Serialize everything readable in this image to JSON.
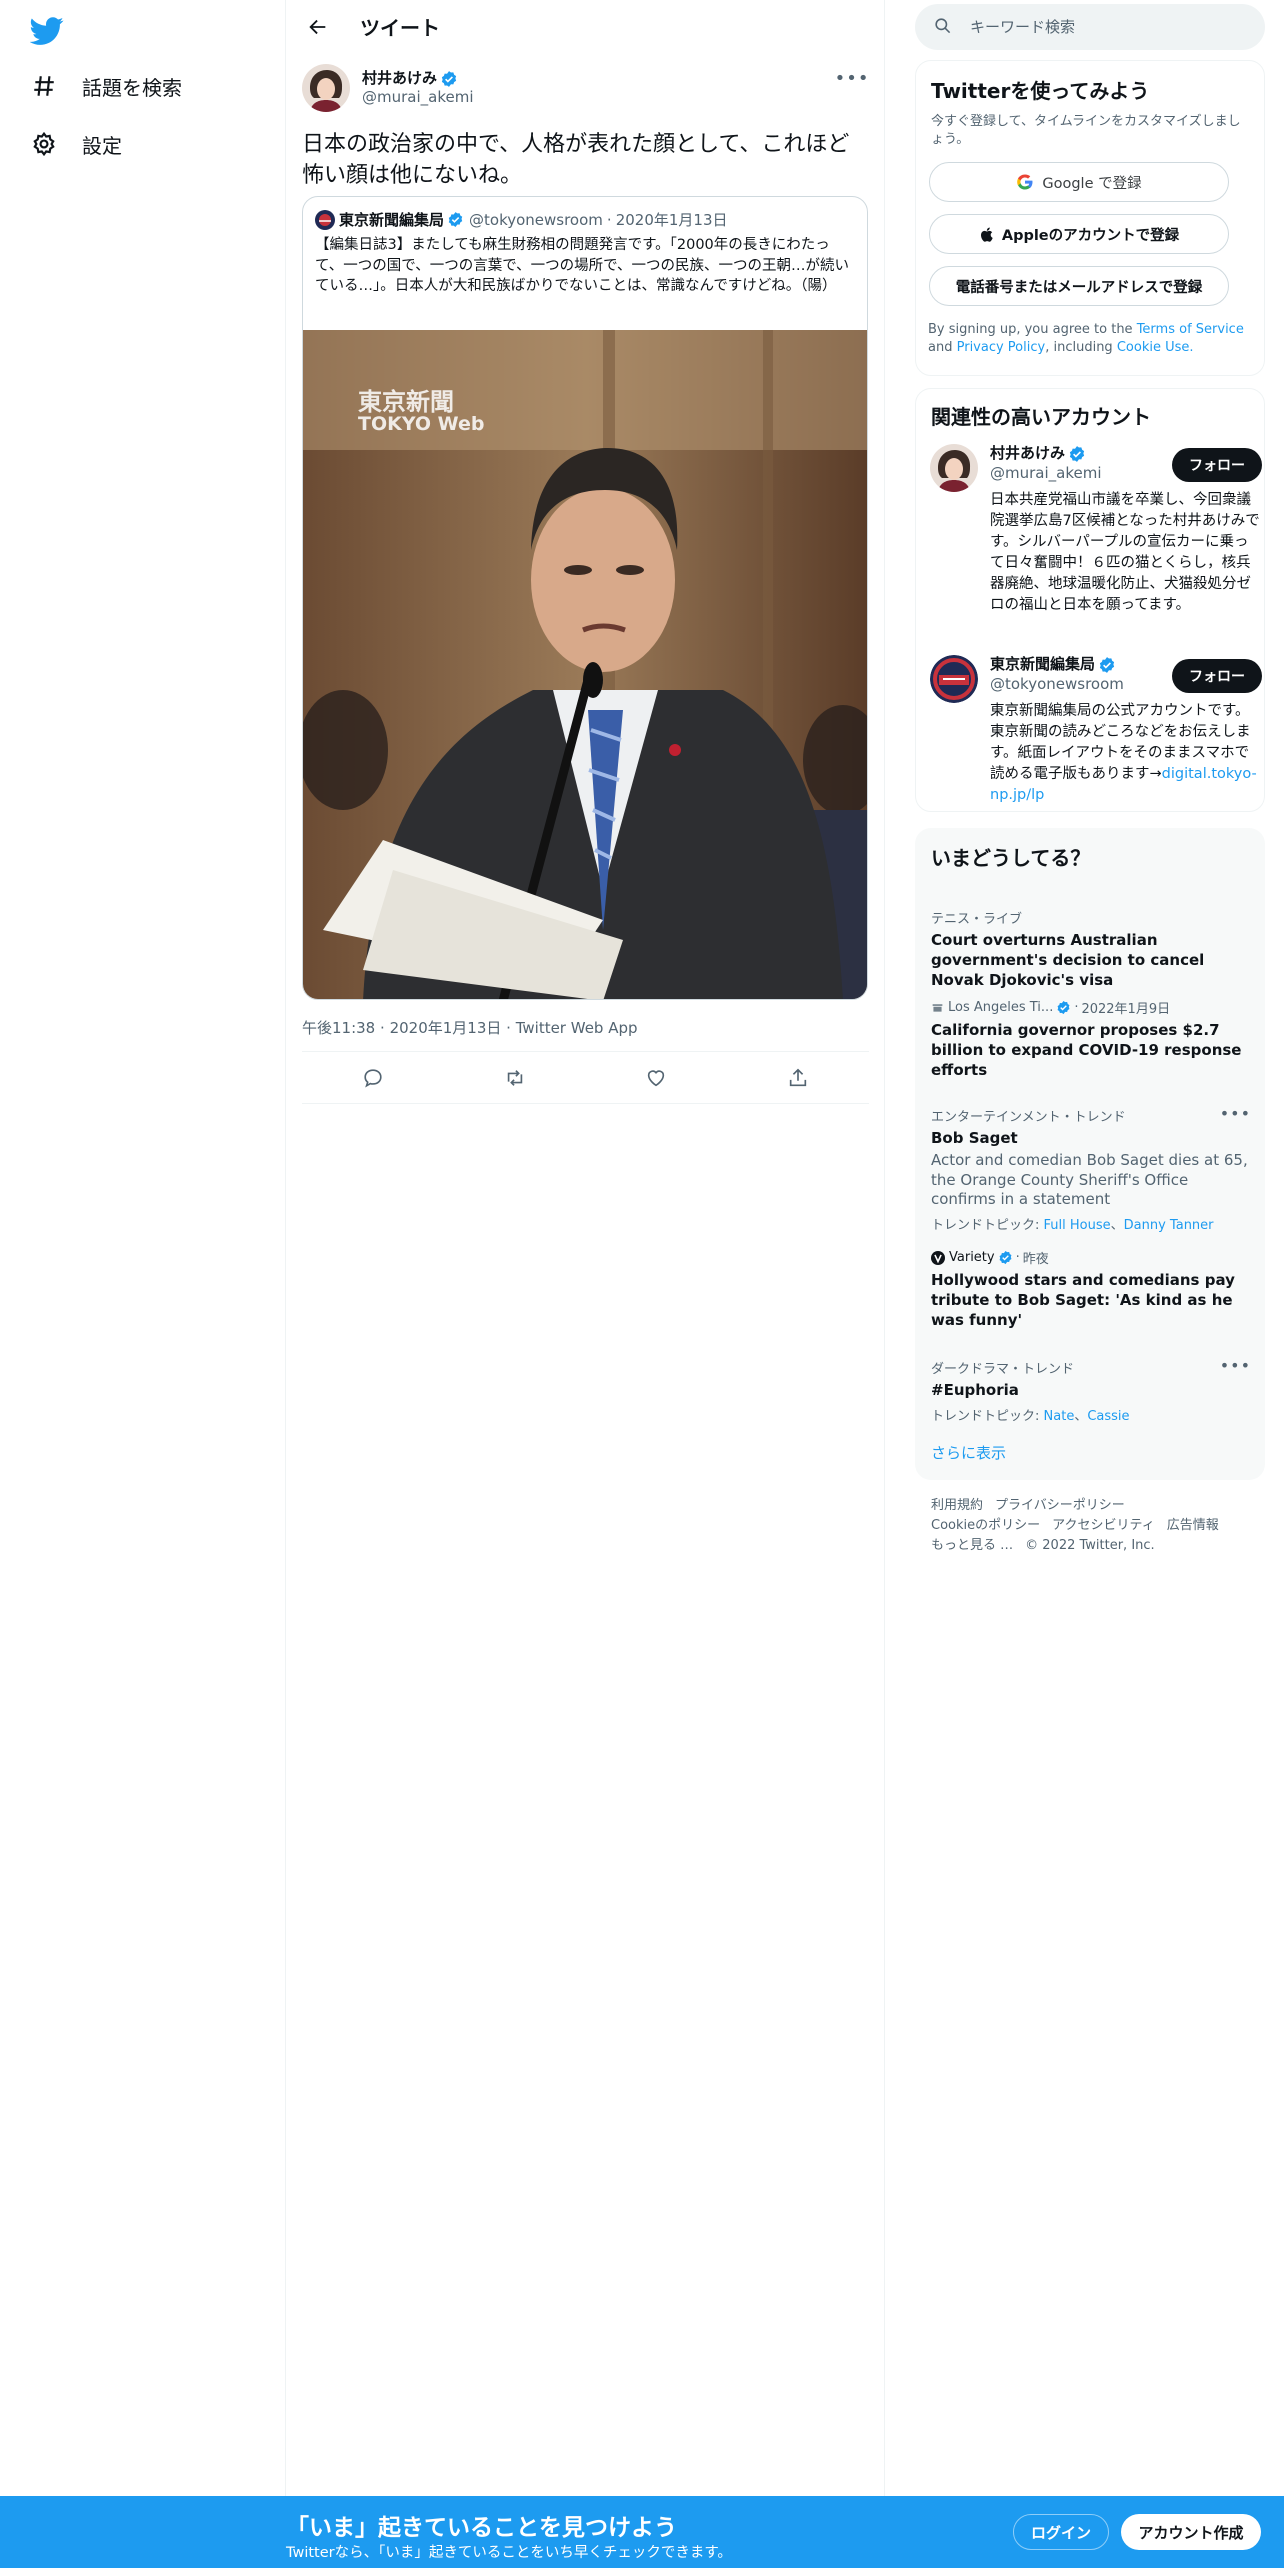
{
  "nav": {
    "logo_icon": "twitter-bird-icon",
    "explore_label": "話題を検索",
    "settings_label": "設定"
  },
  "header": {
    "title": "ツイート"
  },
  "tweet": {
    "author_name": "村井あけみ",
    "author_handle": "@murai_akemi",
    "text": "日本の政治家の中で、人格が表れた顔として、これほど怖い顔は他にないね。",
    "quote": {
      "name": "東京新聞編集局",
      "handle": "@tokyonewsroom",
      "date": "2020年1月13日",
      "text": "【編集日誌3】またしても麻生財務相の問題発言です。「2000年の長きにわたって、一つの国で、一つの言葉で、一つの場所で、一つの民族、一つの王朝…が続いている…」。日本人が大和民族ばかりでないことは、常識なんですけどね。（陽）",
      "watermark_line1": "東京新聞",
      "watermark_line2": "TOKYO Web"
    },
    "meta_time": "午後11:38",
    "meta_date": "2020年1月13日",
    "meta_source": "Twitter Web App"
  },
  "search": {
    "placeholder": "キーワード検索"
  },
  "signup": {
    "title": "Twitterを使ってみよう",
    "subtitle": "今すぐ登録して、タイムラインをカスタマイズしましょう。",
    "google_label": "Google で登録",
    "apple_label": "Appleのアカウントで登録",
    "phone_label": "電話番号またはメールアドレスで登録",
    "terms_prefix": "By signing up, you agree to the",
    "terms_link": "Terms of Service",
    "terms_and": "and",
    "privacy_link": "Privacy Policy",
    "terms_including": ", including",
    "cookie_link": "Cookie Use."
  },
  "related": {
    "title": "関連性の高いアカウント",
    "accounts": [
      {
        "name": "村井あけみ",
        "handle": "@murai_akemi",
        "follow_label": "フォロー",
        "bio": "日本共産党福山市議を卒業し、今回衆議院選挙広島7区候補となった村井あけみです。シルバーパープルの宣伝カーに乗って日々奮闘中！６匹の猫とくらし，核兵器廃絶、地球温暖化防止、犬猫殺処分ゼロの福山と日本を願ってます。"
      },
      {
        "name": "東京新聞編集局",
        "handle": "@tokyonewsroom",
        "follow_label": "フォロー",
        "bio": "東京新聞編集局の公式アカウントです。東京新聞の読みどころなどをお伝えします。紙面レイアウトをそのままスマホで読める電子版もあります→",
        "bio_link": "digital.tokyo-np.jp/lp"
      }
    ]
  },
  "trends": {
    "title": "いまどうしてる？",
    "items": [
      {
        "context": "テニス・ライブ",
        "title": "Court overturns Australian government's decision to cancel Novak Djokovic's visa"
      },
      {
        "source": "Los Angeles Ti...",
        "time": "2022年1月9日",
        "title": "California governor proposes $2.7 billion to expand COVID-19 response efforts"
      },
      {
        "context": "エンターテインメント・トレンド",
        "title": "Bob Saget",
        "desc": "Actor and comedian Bob Saget dies at 65, the Orange County Sheriff's Office confirms in a statement",
        "topics_label": "トレンドトピック:",
        "topics": [
          "Full House",
          "Danny Tanner"
        ]
      },
      {
        "source": "Variety",
        "time": "昨夜",
        "title": "Hollywood stars and comedians pay tribute to Bob Saget: 'As kind as he was funny'"
      },
      {
        "context": "ダークドラマ・トレンド",
        "title": "#Euphoria",
        "topics_label": "トレンドトピック:",
        "topics": [
          "Nate",
          "Cassie"
        ]
      }
    ],
    "show_more": "さらに表示"
  },
  "footer": {
    "links": [
      "利用規約",
      "プライバシーポリシー",
      "Cookieのポリシー",
      "アクセシビリティ",
      "広告情報",
      "もっと見る …",
      "© 2022 Twitter, Inc."
    ]
  },
  "banner": {
    "title": "「いま」起きていることを見つけよう",
    "subtitle": "Twitterなら、「いま」起きていることをいち早くチェックできます。",
    "login_label": "ログイン",
    "signup_label": "アカウント作成"
  },
  "colors": {
    "brand": "#1d9bf0",
    "text": "#0f1419",
    "muted": "#536471",
    "border": "#eff3f4"
  }
}
